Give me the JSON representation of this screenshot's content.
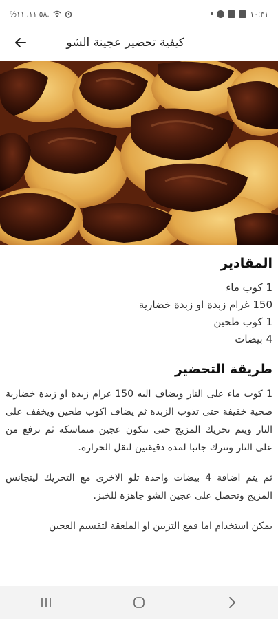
{
  "status_bar": {
    "left_text": "%٥٨ ١١. ١١.",
    "time": "١٠:٣١",
    "left_icons": [
      "battery-icon",
      "signal-icon",
      "signal-icon",
      "wifi-icon",
      "alarm-icon"
    ],
    "right_icons": [
      "dot-icon",
      "facebook-icon",
      "youtube-icon",
      "gallery-icon"
    ]
  },
  "app_bar": {
    "title": "كيفية تحضير عجينة الشو"
  },
  "ingredients": {
    "heading": "المقادير",
    "items": [
      "1 كوب ماء",
      "150 غرام زبدة او زبدة خضارية",
      "1 كوب طحين",
      "4 بيضات"
    ]
  },
  "method": {
    "heading": "طريقة التحضير",
    "steps": [
      "1 كوب ماء على النار ويضاف اليه 150 غرام زبدة او زبدة خضارية صحية خفيفة حتى تذوب الزبدة ثم يضاف اكوب طحين ويخفف على النار ويتم تحريك المزيج حتى تتكون عجين متماسكة ثم ترفع من على النار وتترك جانبا لمدة دقيقتين لتقل الحرارة.",
      "ثم يتم اضافة 4 بيضات واحدة تلو الاخرى مع التحريك ليتجانس المزيج وتحصل على عجين الشو جاهزة للخبز.",
      "يمكن استخدام اما قمع التزيين او الملعقة لتقسيم العجين"
    ]
  },
  "colors": {
    "chocolate": "#3b1408",
    "pastry": "#e8b45a",
    "background": "#ffffff"
  }
}
